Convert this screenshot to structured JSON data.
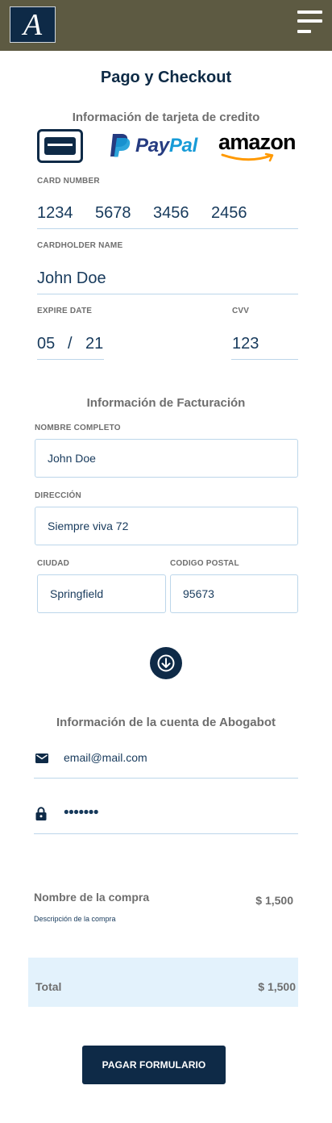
{
  "header": {
    "logo_letter": "A"
  },
  "page": {
    "title": "Pago y Checkout"
  },
  "card_section": {
    "title": "Información de tarjeta de credito",
    "methods": {
      "paypal_part1": "Pay",
      "paypal_part2": "Pal",
      "amazon": "amazon"
    },
    "card_number": {
      "label": "CARD NUMBER",
      "groups": [
        "1234",
        "5678",
        "3456",
        "2456"
      ]
    },
    "cardholder": {
      "label": "CARDHOLDER NAME",
      "value": "John Doe"
    },
    "expire": {
      "label": "EXPIRE DATE",
      "month": "05",
      "separator": "/",
      "year": "21"
    },
    "cvv": {
      "label": "CVV",
      "value": "123"
    }
  },
  "billing_section": {
    "title": "Información de Facturación",
    "full_name": {
      "label": "NOMBRE COMPLETO",
      "value": "John Doe"
    },
    "address": {
      "label": "DIRECCIÓN",
      "value": "Siempre viva 72"
    },
    "city": {
      "label": "CIUDAD",
      "value": "Springfield"
    },
    "postal": {
      "label": "CODIGO POSTAL",
      "value": "95673"
    }
  },
  "account_section": {
    "title": "Información de la cuenta de Abogabot",
    "email": "email@mail.com",
    "password_mask": "•••••••"
  },
  "purchase": {
    "name": "Nombre de la compra",
    "description": "Descripción de la compra",
    "price": "$ 1,500"
  },
  "total": {
    "label": "Total",
    "amount": "$ 1,500"
  },
  "submit": {
    "label": "PAGAR FORMULARIO"
  },
  "colors": {
    "header_bg": "#5d5a42",
    "brand_navy": "#0e2a47",
    "field_border": "#bcd6ea",
    "total_bg": "#e3f2fc",
    "paypal_dark": "#253b80",
    "paypal_light": "#179bd7",
    "amazon_arrow": "#ff9900"
  },
  "icons": {
    "menu": "hamburger-icon",
    "card": "credit-card-icon",
    "down": "arrow-down-icon",
    "email": "envelope-icon",
    "password": "lock-icon"
  }
}
